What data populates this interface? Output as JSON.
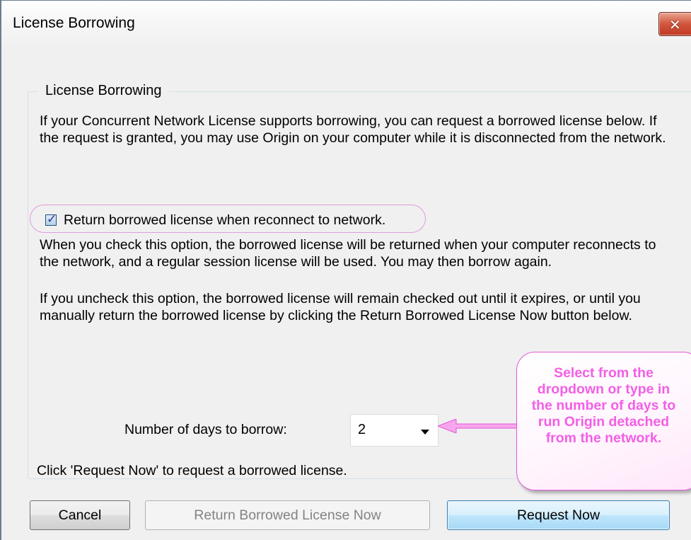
{
  "window": {
    "title": "License Borrowing",
    "close_label": "✕"
  },
  "group": {
    "title": "License Borrowing",
    "intro": "If your Concurrent Network License supports borrowing, you can request a borrowed license below. If the request is granted, you may use Origin on your computer while it is disconnected from the network.",
    "checkbox_label": "Return borrowed license when reconnect to network.",
    "checkbox_checked": true,
    "checked_help": "When you check this option, the borrowed license will be returned when your computer reconnects to the network, and a regular session license will be used. You may then borrow again.",
    "unchecked_help": " If you uncheck this option, the borrowed license will remain checked out until it expires, or until you manually return the borrowed license by clicking the Return Borrowed License Now button below.",
    "days_label": "Number of days to borrow:",
    "days_value": "2",
    "request_hint": "Click 'Request Now' to request a borrowed license."
  },
  "callout": {
    "lines": [
      "Select from the",
      "dropdown or type in",
      "the number of days to",
      "run Origin detached",
      "from the network."
    ],
    "color": "#f35fe6"
  },
  "buttons": {
    "cancel": "Cancel",
    "return_now": "Return Borrowed License Now",
    "request_now": "Request Now"
  },
  "colors": {
    "dialog_bg": "#f0f0f0",
    "accent_border": "#3c7fb1",
    "annotation_pink": "#e25ad3"
  }
}
